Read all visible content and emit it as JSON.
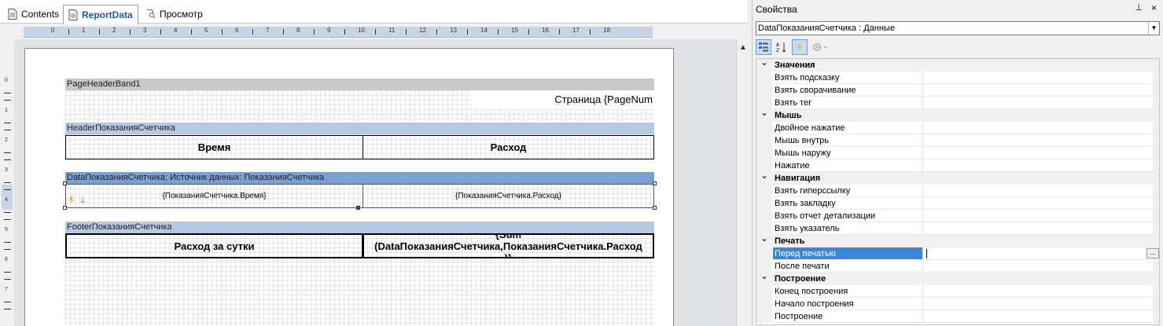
{
  "tabs": [
    {
      "label": "Contents",
      "icon": "document-icon"
    },
    {
      "label": "ReportData",
      "icon": "document-icon"
    },
    {
      "label": "Просмотр",
      "icon": "preview-icon"
    }
  ],
  "ruler": {
    "h_ticks": [
      "0",
      "1",
      "2",
      "3",
      "4",
      "5",
      "6",
      "7",
      "8",
      "9",
      "10",
      "11",
      "12",
      "13",
      "14",
      "15",
      "16",
      "17",
      "18"
    ],
    "v_ticks": [
      "0",
      "1",
      "2",
      "3",
      "4",
      "5",
      "6",
      "7"
    ]
  },
  "report": {
    "page_header": {
      "band_label": "PageHeaderBand1",
      "page_text": "Страница {PageNum"
    },
    "header": {
      "band_label": "HeaderПоказанияСчетчика",
      "col1": "Время",
      "col2": "Расход"
    },
    "data": {
      "band_label": "DataПоказанияСчетчика; Источник данных: ПоказанияСчетчика",
      "col1": "{ПоказанияСчетчика.Время}",
      "col2": "{ПоказанияСчетчика.Расход}"
    },
    "footer": {
      "band_label": "FooterПоказанияСчетчика",
      "col1": "Расход за сутки",
      "col2_line1": "{Sum",
      "col2_line2": "(DataПоказанияСчетчика,ПоказанияСчетчика.Расход",
      "col2_line3": ")}"
    }
  },
  "properties": {
    "title": "Свойства",
    "pin": "⊥",
    "close": "×",
    "selected_object": "DataПоказанияСчетчика : Данные",
    "categories": [
      {
        "name": "Значения",
        "items": [
          "Взять подсказку",
          "Взять сворачивание",
          "Взять тег"
        ]
      },
      {
        "name": "Мышь",
        "items": [
          "Двойное нажатие",
          "Мышь внутрь",
          "Мышь наружу",
          "Нажатие"
        ]
      },
      {
        "name": "Навигация",
        "items": [
          "Взять гиперссылку",
          "Взять закладку",
          "Взять отчет детализации",
          "Взять указатель"
        ]
      },
      {
        "name": "Печать",
        "items": [
          "Перед печатью",
          "После печати"
        ]
      },
      {
        "name": "Построение",
        "items": [
          "Конец построения",
          "Начало построения",
          "Построение"
        ]
      }
    ],
    "selected_item": "Перед печатью",
    "ellipsis": "..."
  },
  "colors": {
    "selection": "#3b86d8",
    "band_selected": "#7aa0d4",
    "ruler": "#c9d5e6"
  }
}
